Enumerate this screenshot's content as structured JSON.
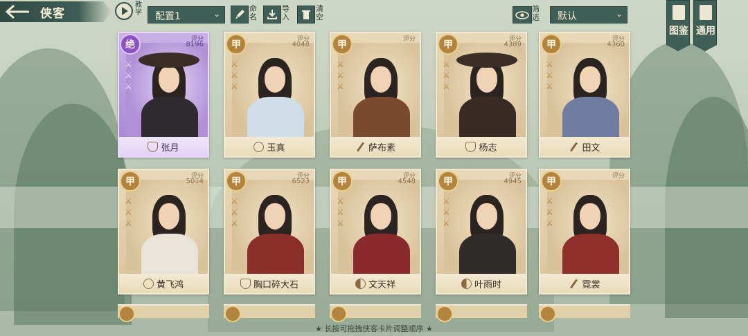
{
  "header": {
    "title": "侠客",
    "tutorial_label": "教学",
    "config_value": "配置1",
    "rename_label": "命名",
    "import_label": "导入",
    "clear_label": "清空",
    "filter_label": "筛选",
    "sort_value": "默认"
  },
  "side_tabs": [
    {
      "label": "图鉴",
      "icon": "book-icon"
    },
    {
      "label": "通用",
      "icon": "book-open-icon"
    }
  ],
  "score_label": "评分",
  "cards": [
    {
      "name": "张月",
      "grade": "绝",
      "score": "8196",
      "school_icon": "shield",
      "selected": true
    },
    {
      "name": "玉真",
      "grade": "甲",
      "score": "4048",
      "school_icon": "lotus",
      "selected": false
    },
    {
      "name": "萨布素",
      "grade": "甲",
      "score": "",
      "school_icon": "sword",
      "selected": false
    },
    {
      "name": "杨志",
      "grade": "甲",
      "score": "4389",
      "school_icon": "shield",
      "selected": false
    },
    {
      "name": "田文",
      "grade": "甲",
      "score": "4360",
      "school_icon": "sword",
      "selected": false
    },
    {
      "name": "黄飞鸿",
      "grade": "甲",
      "score": "5014",
      "school_icon": "lotus",
      "selected": false
    },
    {
      "name": "胸口碎大石",
      "grade": "甲",
      "score": "6523",
      "school_icon": "shield",
      "selected": false
    },
    {
      "name": "文天祥",
      "grade": "甲",
      "score": "4548",
      "school_icon": "yinyang",
      "selected": false
    },
    {
      "name": "叶雨时",
      "grade": "甲",
      "score": "4945",
      "school_icon": "yinyang",
      "selected": false
    },
    {
      "name": "霓裳",
      "grade": "甲",
      "score": "",
      "school_icon": "sword",
      "selected": false
    }
  ],
  "footer_hint": "★ 长按可拖拽侠客卡片调整顺序 ★",
  "colors": {
    "panel": "#3f5e56",
    "card": "#e2d0ab",
    "selected": "#a783cf",
    "badge": "#b3843e"
  }
}
